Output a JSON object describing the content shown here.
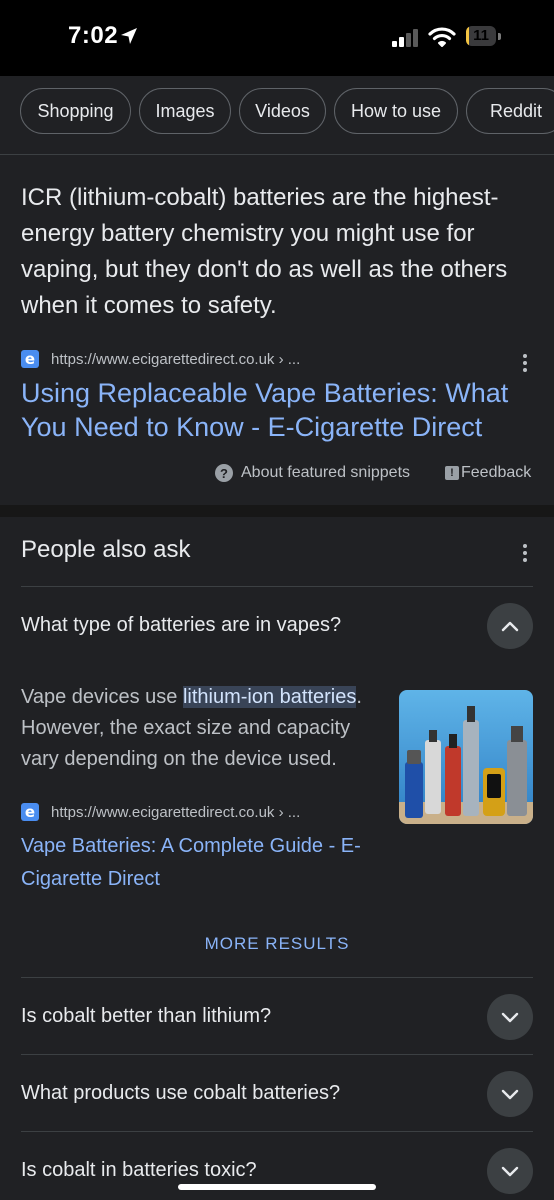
{
  "status_bar": {
    "time": "7:02",
    "battery": "11",
    "battery_level": 0.11
  },
  "chips": [
    "Shopping",
    "Images",
    "Videos",
    "How to use",
    "Reddit"
  ],
  "featured_snippet": {
    "text": "ICR (lithium-cobalt) batteries are the highest-energy battery chemistry you might use for vaping, but they don't do as well as the others when it comes to safety.",
    "favicon_letter": "e",
    "url": "https://www.ecigarettedirect.co.uk › ...",
    "title": "Using Replaceable Vape Batteries: What You Need to Know - E-Cigarette Direct",
    "about_label": "About featured snippets",
    "feedback_label": "Feedback"
  },
  "people_also_ask": {
    "title": "People also ask",
    "expanded": {
      "question": "What type of batteries are in vapes?",
      "answer_before": "Vape devices use ",
      "answer_highlight": "lithium-ion batteries",
      "answer_after": ". However, the exact size and capacity vary depending on the device used.",
      "url": "https://www.ecigarettedirect.co.uk › ...",
      "link_title": "Vape Batteries: A Complete Guide - E-Cigarette Direct"
    },
    "more_results": "MORE RESULTS",
    "questions": [
      "Is cobalt better than lithium?",
      "What products use cobalt batteries?",
      "Is cobalt in batteries toxic?"
    ]
  },
  "colors": {
    "background": "#202124",
    "link": "#8ab4f8",
    "text": "#e8eaed",
    "muted": "#bdc1c6"
  }
}
